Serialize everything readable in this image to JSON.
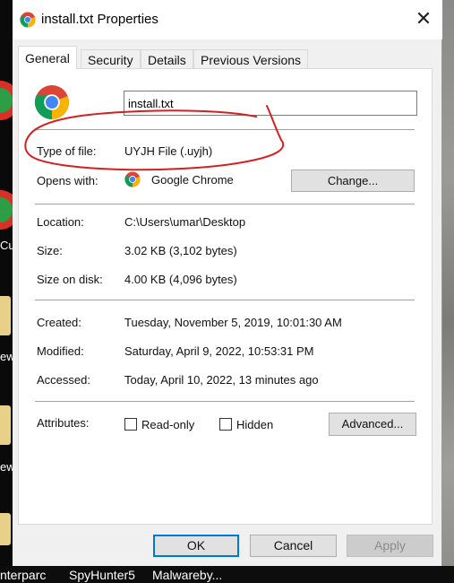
{
  "window": {
    "title": "install.txt Properties",
    "close_glyph": "✕"
  },
  "tabs": [
    {
      "label": "General",
      "active": true
    },
    {
      "label": "Security",
      "active": false
    },
    {
      "label": "Details",
      "active": false
    },
    {
      "label": "Previous Versions",
      "active": false
    }
  ],
  "general": {
    "file_name": "install.txt",
    "type_label": "Type of file:",
    "type_value": "UYJH File (.uyjh)",
    "opens_label": "Opens with:",
    "opens_value": "Google Chrome",
    "change_button": "Change...",
    "location_label": "Location:",
    "location_value": "C:\\Users\\umar\\Desktop",
    "size_label": "Size:",
    "size_value": "3.02 KB (3,102 bytes)",
    "size_on_disk_label": "Size on disk:",
    "size_on_disk_value": "4.00 KB (4,096 bytes)",
    "created_label": "Created:",
    "created_value": "Tuesday, November 5, 2019, 10:01:30 AM",
    "modified_label": "Modified:",
    "modified_value": "Saturday, April 9, 2022, 10:53:31 PM",
    "accessed_label": "Accessed:",
    "accessed_value": "Today, April 10, 2022, 13 minutes ago",
    "attributes_label": "Attributes:",
    "readonly_label": "Read-only",
    "readonly_checked": false,
    "hidden_label": "Hidden",
    "hidden_checked": false,
    "advanced_button": "Advanced..."
  },
  "buttons": {
    "ok": "OK",
    "cancel": "Cancel",
    "apply": "Apply",
    "apply_enabled": false
  },
  "desktop": {
    "left_labels": [
      "Cu",
      "ew",
      "ew"
    ],
    "taskbar_labels": [
      "nterparc",
      "SpyHunter5",
      "Malwareby..."
    ]
  },
  "colors": {
    "accent": "#0078d7",
    "annotation": "#d42020",
    "chrome_red": "#db4437",
    "chrome_yellow": "#f4b400",
    "chrome_green": "#0f9d58",
    "chrome_blue": "#4285f4"
  },
  "icons": {
    "app": "chrome-icon",
    "close": "close-icon",
    "annotation": "red-circle-annotation"
  }
}
